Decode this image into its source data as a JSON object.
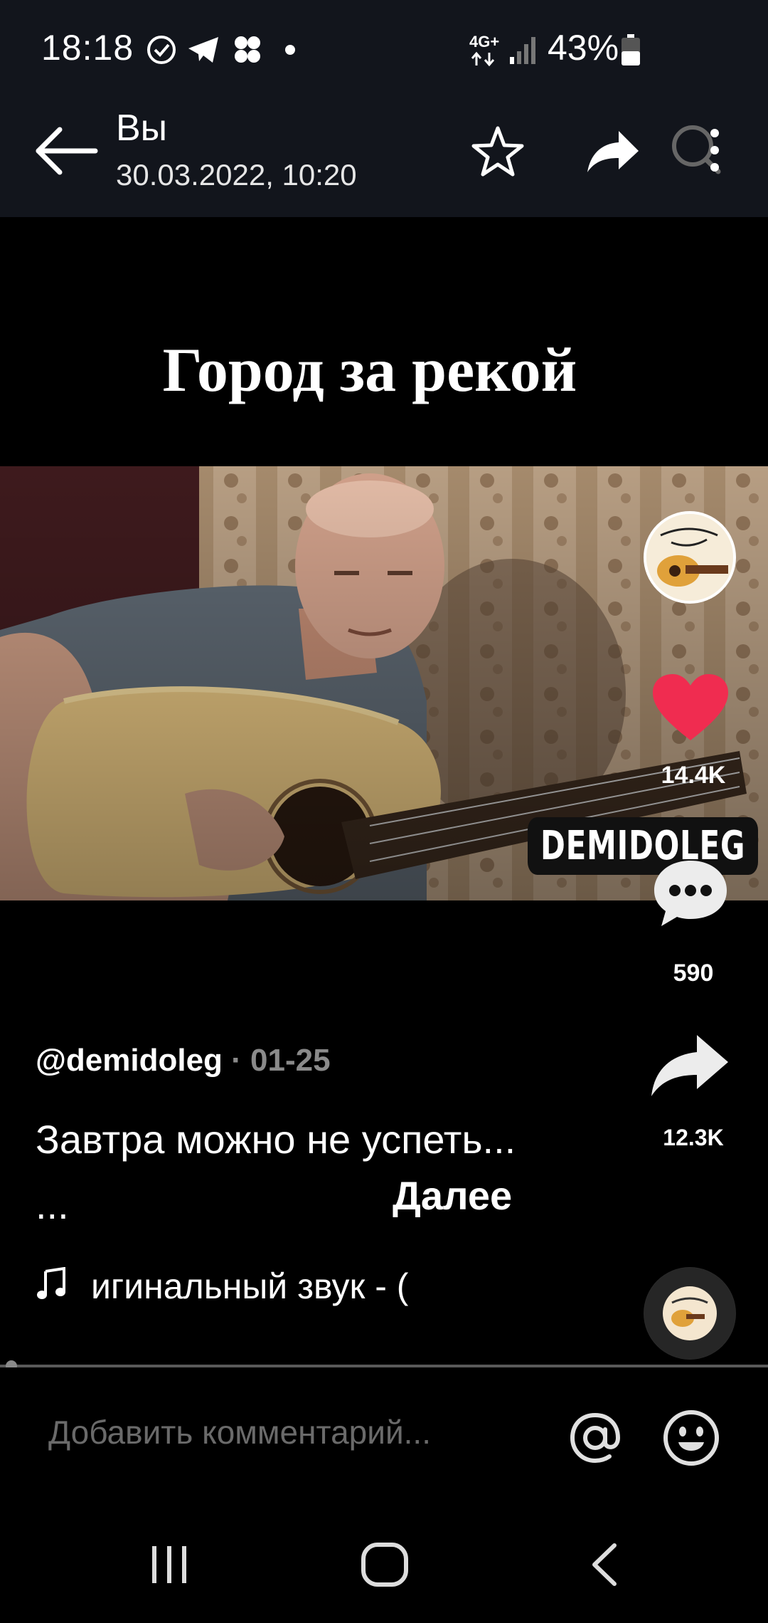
{
  "status_bar": {
    "time": "18:18",
    "network": "4G+",
    "battery_percent": "43%",
    "icons": [
      "checkmark-circle-icon",
      "telegram-icon",
      "clover-icon",
      "dot-icon",
      "signal-icon",
      "battery-icon"
    ]
  },
  "header": {
    "title": "Вы",
    "datetime": "30.03.2022, 10:20",
    "icons": [
      "back-arrow-icon",
      "star-icon",
      "forward-icon",
      "search-icon",
      "more-vertical-icon"
    ]
  },
  "video": {
    "title": "Город за рекой",
    "watermark": "DEMIDOLEG",
    "author": "@demidoleg",
    "date_sep": " · ",
    "date": "01-25",
    "caption": "Завтра можно не успеть... ...",
    "more_label": "Далее",
    "music": "игинальный звук - (",
    "likes": "14.4K",
    "comments": "590",
    "shares": "12.3K",
    "progress_fraction": 0.005,
    "like_color": "#f02c50"
  },
  "comment_bar": {
    "placeholder": "Добавить комментарий...",
    "icons": [
      "at-sign-icon",
      "emoji-icon"
    ]
  },
  "nav_bar": {
    "icons": [
      "recents-icon",
      "home-icon",
      "back-icon"
    ]
  }
}
